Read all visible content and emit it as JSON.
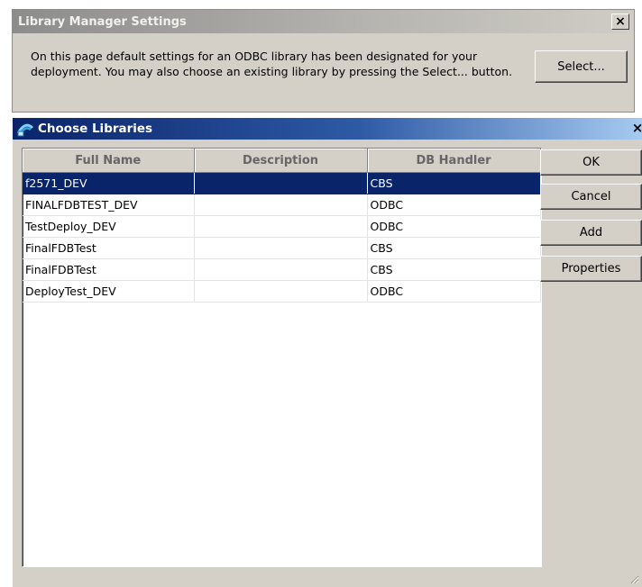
{
  "library_manager": {
    "title": "Library Manager Settings",
    "close_label": "×",
    "description": "On this page default settings for an ODBC library has been designated for your deployment.  You may also choose an existing library by pressing the Select... button.",
    "select_label": "Select..."
  },
  "choose_libraries": {
    "title": "Choose Libraries",
    "close_label": "×",
    "columns": [
      "Full Name",
      "Description",
      "DB Handler"
    ],
    "rows": [
      {
        "full_name": "f2571_DEV",
        "description": "",
        "db_handler": "CBS",
        "selected": true
      },
      {
        "full_name": "FINALFDBTEST_DEV",
        "description": "",
        "db_handler": "ODBC"
      },
      {
        "full_name": "TestDeploy_DEV",
        "description": "",
        "db_handler": "ODBC"
      },
      {
        "full_name": "FinalFDBTest",
        "description": "",
        "db_handler": "CBS"
      },
      {
        "full_name": "FinalFDBTest",
        "description": "",
        "db_handler": "CBS"
      },
      {
        "full_name": "DeployTest_DEV",
        "description": "",
        "db_handler": "ODBC"
      }
    ],
    "buttons": {
      "ok": "OK",
      "cancel": "Cancel",
      "add": "Add",
      "properties": "Properties"
    }
  },
  "colors": {
    "selection": "#0a246a",
    "dialog_face": "#d4d0c8"
  }
}
